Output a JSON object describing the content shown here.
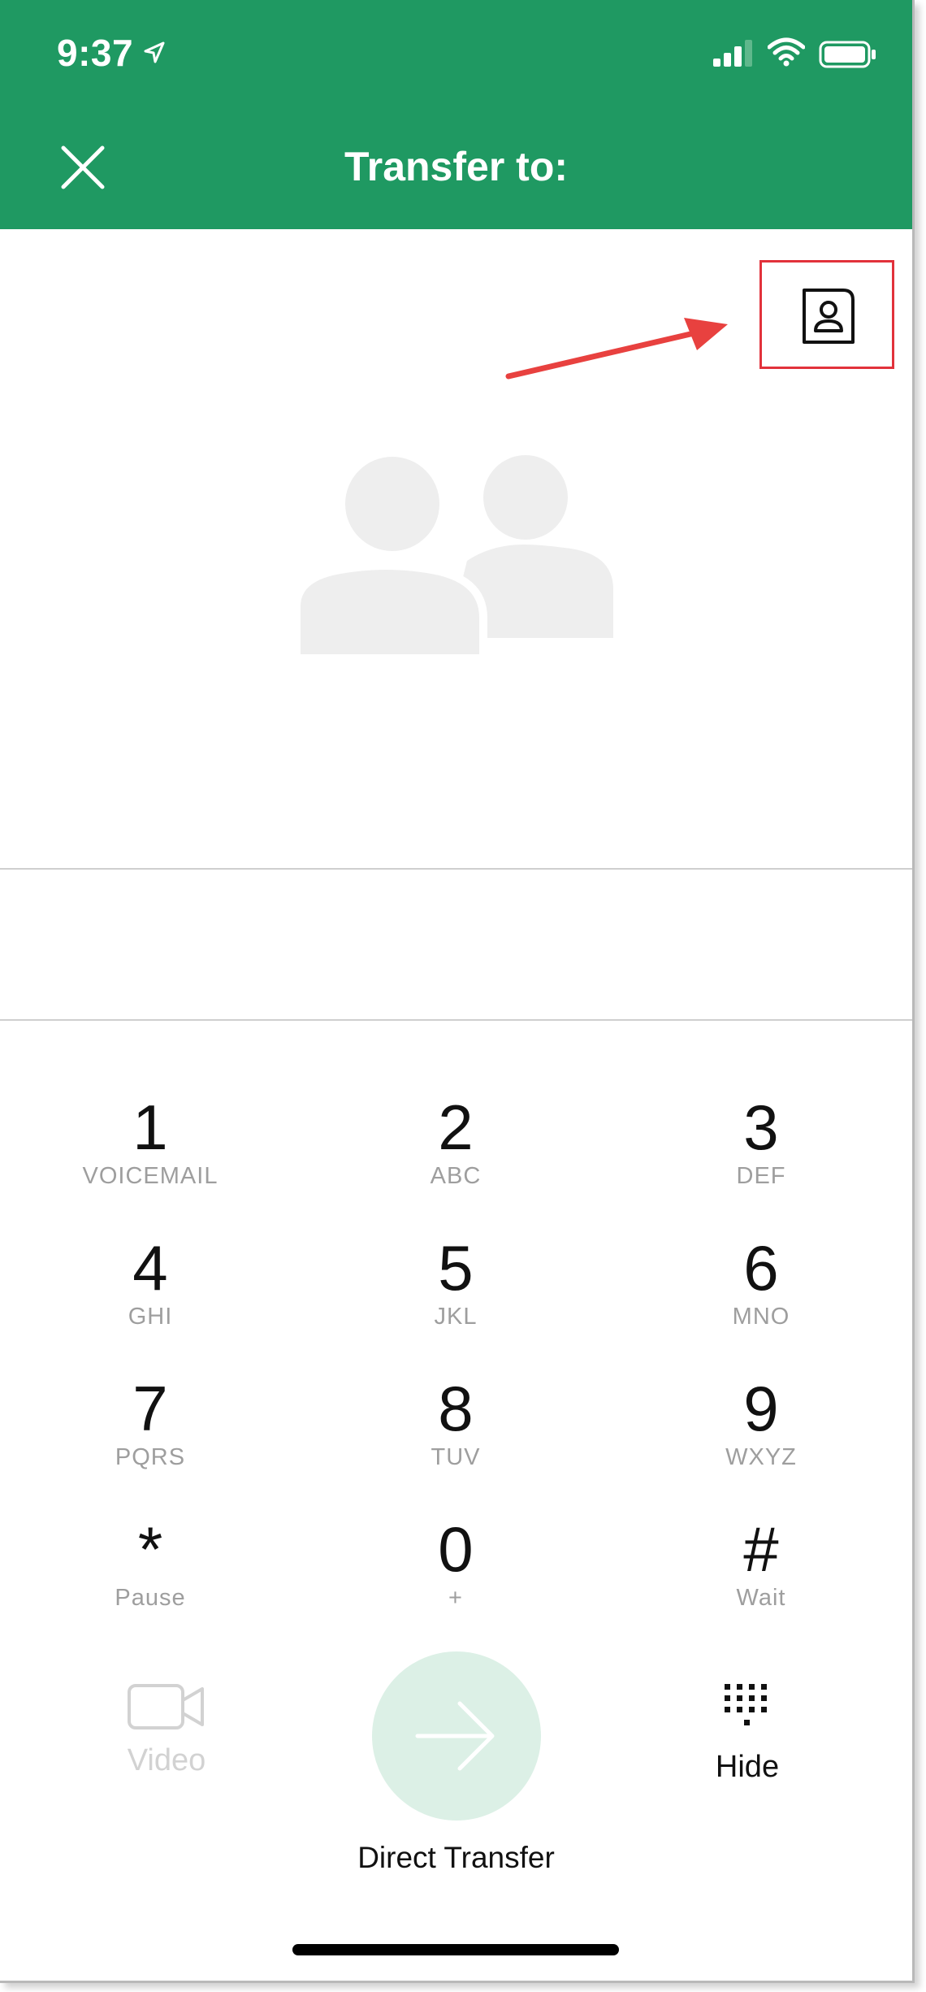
{
  "status_bar": {
    "time": "9:37",
    "icons": [
      "location-arrow-icon",
      "cellular-signal-icon",
      "wifi-icon",
      "battery-icon"
    ]
  },
  "header": {
    "title": "Transfer to:",
    "close_icon": "close-icon",
    "background": "#1f9962"
  },
  "contacts_button": {
    "icon": "contacts-book-icon",
    "highlight_color": "#e2323b"
  },
  "placeholder": {
    "icon": "users-group-icon"
  },
  "dialpad": {
    "keys": [
      {
        "num": "1",
        "sub": "VOICEMAIL"
      },
      {
        "num": "2",
        "sub": "ABC"
      },
      {
        "num": "3",
        "sub": "DEF"
      },
      {
        "num": "4",
        "sub": "GHI"
      },
      {
        "num": "5",
        "sub": "JKL"
      },
      {
        "num": "6",
        "sub": "MNO"
      },
      {
        "num": "7",
        "sub": "PQRS"
      },
      {
        "num": "8",
        "sub": "TUV"
      },
      {
        "num": "9",
        "sub": "WXYZ"
      },
      {
        "num": "*",
        "sub": "Pause"
      },
      {
        "num": "0",
        "sub": "+"
      },
      {
        "num": "#",
        "sub": "Wait"
      }
    ]
  },
  "actions": {
    "video_label": "Video",
    "transfer_label": "Direct Transfer",
    "hide_label": "Hide"
  }
}
